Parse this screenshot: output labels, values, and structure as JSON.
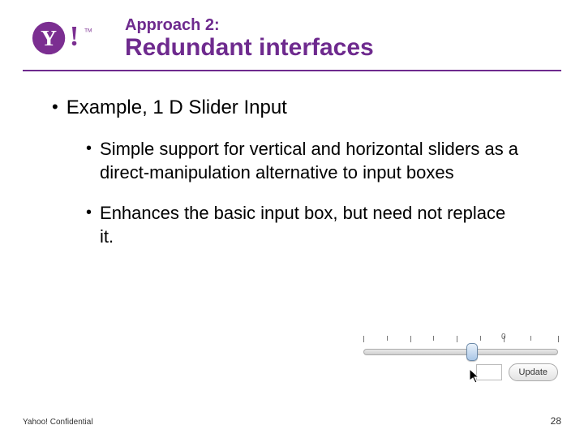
{
  "header": {
    "kicker": "Approach 2:",
    "title": "Redundant interfaces"
  },
  "bullets": {
    "l1": "Example, 1 D Slider Input",
    "l2a": "Simple support for vertical and horizontal sliders as a direct-manipulation alternative to input boxes",
    "l2b": "Enhances the basic input box, but need not replace it."
  },
  "slider": {
    "zero_label": "0",
    "value": "",
    "update_label": "Update"
  },
  "footer": {
    "confidential": "Yahoo! Confidential",
    "page": "28"
  }
}
